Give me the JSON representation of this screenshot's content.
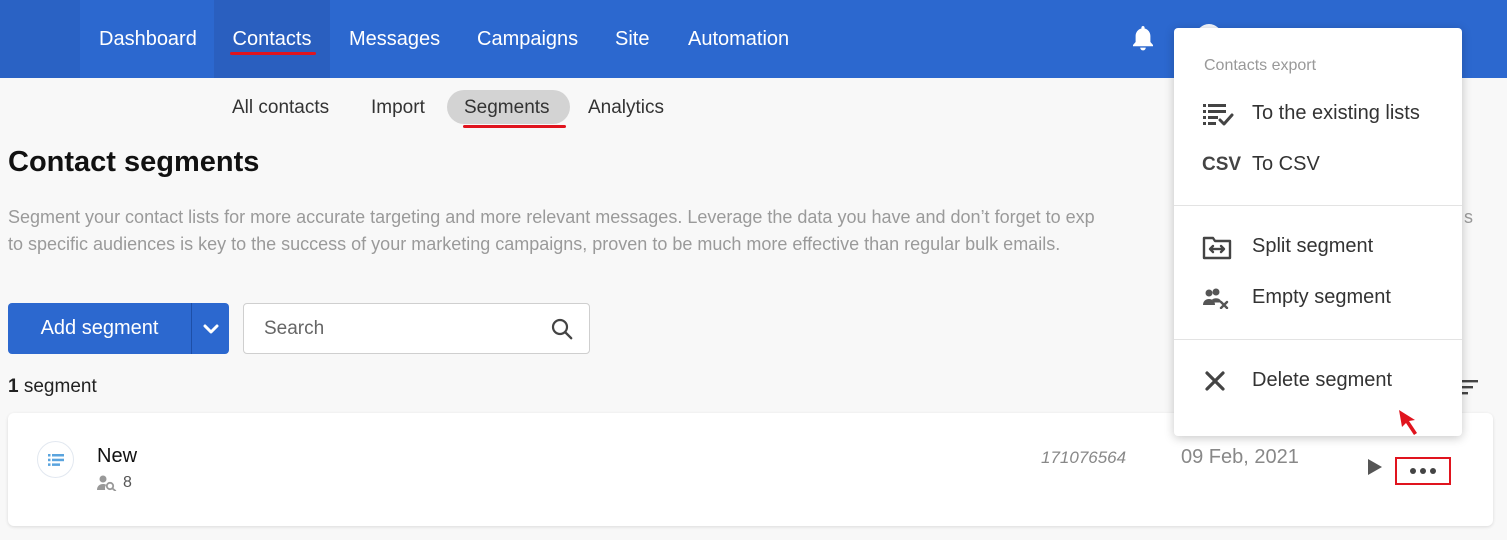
{
  "topnav": {
    "items": [
      {
        "label": "Dashboard"
      },
      {
        "label": "Contacts",
        "active": true
      },
      {
        "label": "Messages"
      },
      {
        "label": "Campaigns"
      },
      {
        "label": "Site"
      },
      {
        "label": "Automation"
      }
    ],
    "bell_icon": "bell-icon",
    "accent_color": "#2c68cf"
  },
  "subnav": {
    "items": [
      {
        "label": "All contacts"
      },
      {
        "label": "Import"
      },
      {
        "label": "Segments",
        "active": true
      },
      {
        "label": "Analytics"
      }
    ]
  },
  "page": {
    "title": "Contact segments",
    "description": "Segment your contact lists for more accurate targeting and more relevant messages. Leverage the data you have and don’t forget to exp... to specific audiences is key to the success of your marketing campaigns, proven to be much more effective than regular bulk emails.",
    "description_line1": "Segment your contact lists for more accurate targeting and more relevant messages. Leverage the data you have and don’t forget to exp",
    "description_line1_tail": "s",
    "description_line2": "to specific audiences is key to the success of your marketing campaigns, proven to be much more effective than regular bulk emails."
  },
  "toolbar": {
    "add_label": "Add segment",
    "search_placeholder": "Search"
  },
  "count": {
    "number": "1",
    "label": "segment"
  },
  "segments": [
    {
      "name": "New",
      "contacts": "8",
      "id": "171076564",
      "date": "09 Feb, 2021"
    }
  ],
  "menu": {
    "section_title": "Contacts export",
    "items": [
      {
        "label": "To the existing lists",
        "icon": "list-check-icon"
      },
      {
        "label": "To CSV",
        "icon": "csv-icon",
        "icon_text": "CSV"
      },
      {
        "label": "Split segment",
        "icon": "split-icon"
      },
      {
        "label": "Empty segment",
        "icon": "users-remove-icon"
      },
      {
        "label": "Delete segment",
        "icon": "close-icon"
      }
    ]
  },
  "highlight_color": "#e0141e"
}
